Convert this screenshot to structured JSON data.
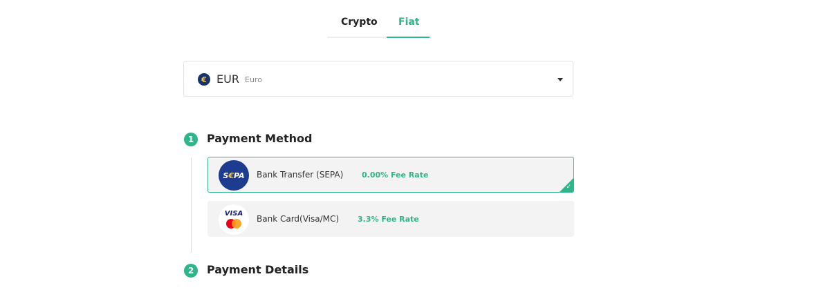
{
  "tabs": [
    {
      "label": "Crypto",
      "active": false
    },
    {
      "label": "Fiat",
      "active": true
    }
  ],
  "currency": {
    "icon": "euro-coin-icon",
    "symbol": "€",
    "code": "EUR",
    "name": "Euro"
  },
  "steps": [
    {
      "number": "1",
      "title": "Payment Method"
    },
    {
      "number": "2",
      "title": "Payment Details"
    }
  ],
  "payment_methods": [
    {
      "logo": "sepa-logo-icon",
      "logo_text": "SEPA",
      "label": "Bank Transfer (SEPA)",
      "fee": "0.00% Fee Rate",
      "selected": true
    },
    {
      "logo": "visa-mastercard-logo-icon",
      "logo_text": "VISA",
      "label": "Bank Card(Visa/MC)",
      "fee": "3.3% Fee Rate",
      "selected": false
    }
  ],
  "colors": {
    "accent": "#2fb58a",
    "option_bg": "#f3f3f3",
    "border": "#e2e2e2"
  }
}
